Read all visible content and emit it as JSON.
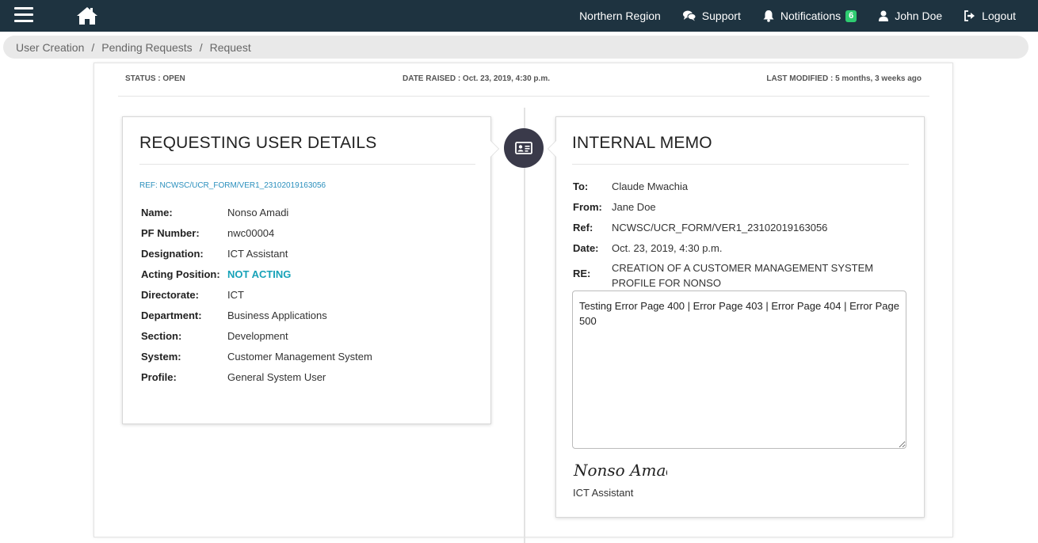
{
  "nav": {
    "region": "Northern Region",
    "support": "Support",
    "notifications": "Notifications",
    "notifications_count": "6",
    "user": "John Doe",
    "logout": "Logout"
  },
  "breadcrumb": {
    "items": [
      "User Creation",
      "Pending Requests",
      "Request"
    ],
    "separator": "/"
  },
  "status": {
    "status": "STATUS : OPEN",
    "date_raised": "DATE RAISED : Oct. 23, 2019, 4:30 p.m.",
    "last_modified": "LAST MODIFIED : 5 months, 3 weeks ago"
  },
  "user_details": {
    "title": "REQUESTING USER DETAILS",
    "ref": "REF: NCWSC/UCR_FORM/VER1_23102019163056",
    "rows": [
      {
        "label": "Name:",
        "value": "Nonso Amadi"
      },
      {
        "label": "PF Number:",
        "value": "nwc00004"
      },
      {
        "label": "Designation:",
        "value": "ICT Assistant"
      },
      {
        "label": "Acting Position:",
        "value": "NOT ACTING"
      },
      {
        "label": "Directorate:",
        "value": "ICT"
      },
      {
        "label": "Department:",
        "value": "Business Applications"
      },
      {
        "label": "Section:",
        "value": "Development"
      },
      {
        "label": "System:",
        "value": "Customer Management System"
      },
      {
        "label": "Profile:",
        "value": "General System User"
      }
    ]
  },
  "memo": {
    "title": "INTERNAL MEMO",
    "to_label": "To:",
    "to": "Claude Mwachia",
    "from_label": "From:",
    "from": "Jane Doe",
    "ref_label": "Ref:",
    "ref": "NCWSC/UCR_FORM/VER1_23102019163056",
    "date_label": "Date:",
    "date": "Oct. 23, 2019, 4:30 p.m.",
    "re_label": "RE:",
    "re": "CREATION OF A CUSTOMER MANAGEMENT SYSTEM PROFILE FOR NONSO",
    "body": "Testing Error Page 400 | Error Page 403 | Error Page 404 | Error Page 500",
    "signature": "Nonso Amadi",
    "signer_title": "ICT Assistant"
  },
  "colors": {
    "navbar": "#1e3340",
    "badge": "#2ecc71",
    "link": "#2a8fbd",
    "acting": "#17a2b8",
    "center_icon_bg": "#3a3a4a"
  }
}
